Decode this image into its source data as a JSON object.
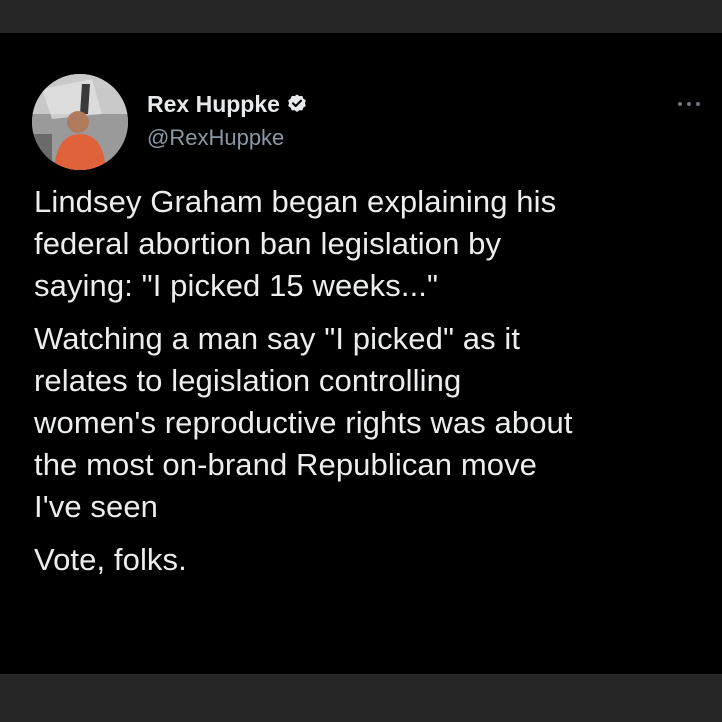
{
  "tweet": {
    "author": {
      "display_name": "Rex Huppke",
      "handle": "@RexHuppke",
      "verified": true,
      "avatar_icon": "profile-photo"
    },
    "more_icon": "ellipsis-icon",
    "paragraphs": [
      "Lindsey Graham began explaining his\nfederal abortion ban legislation by\nsaying: \"I picked 15 weeks...\"",
      "Watching a man say \"I picked\" as it\nrelates to legislation controlling\nwomen's reproductive rights was about\nthe most on-brand Republican move\nI've seen",
      "Vote, folks."
    ]
  },
  "colors": {
    "background": "#000000",
    "text": "#e7e9ea",
    "secondary_text": "#8b98a5",
    "frame": "#262626"
  }
}
